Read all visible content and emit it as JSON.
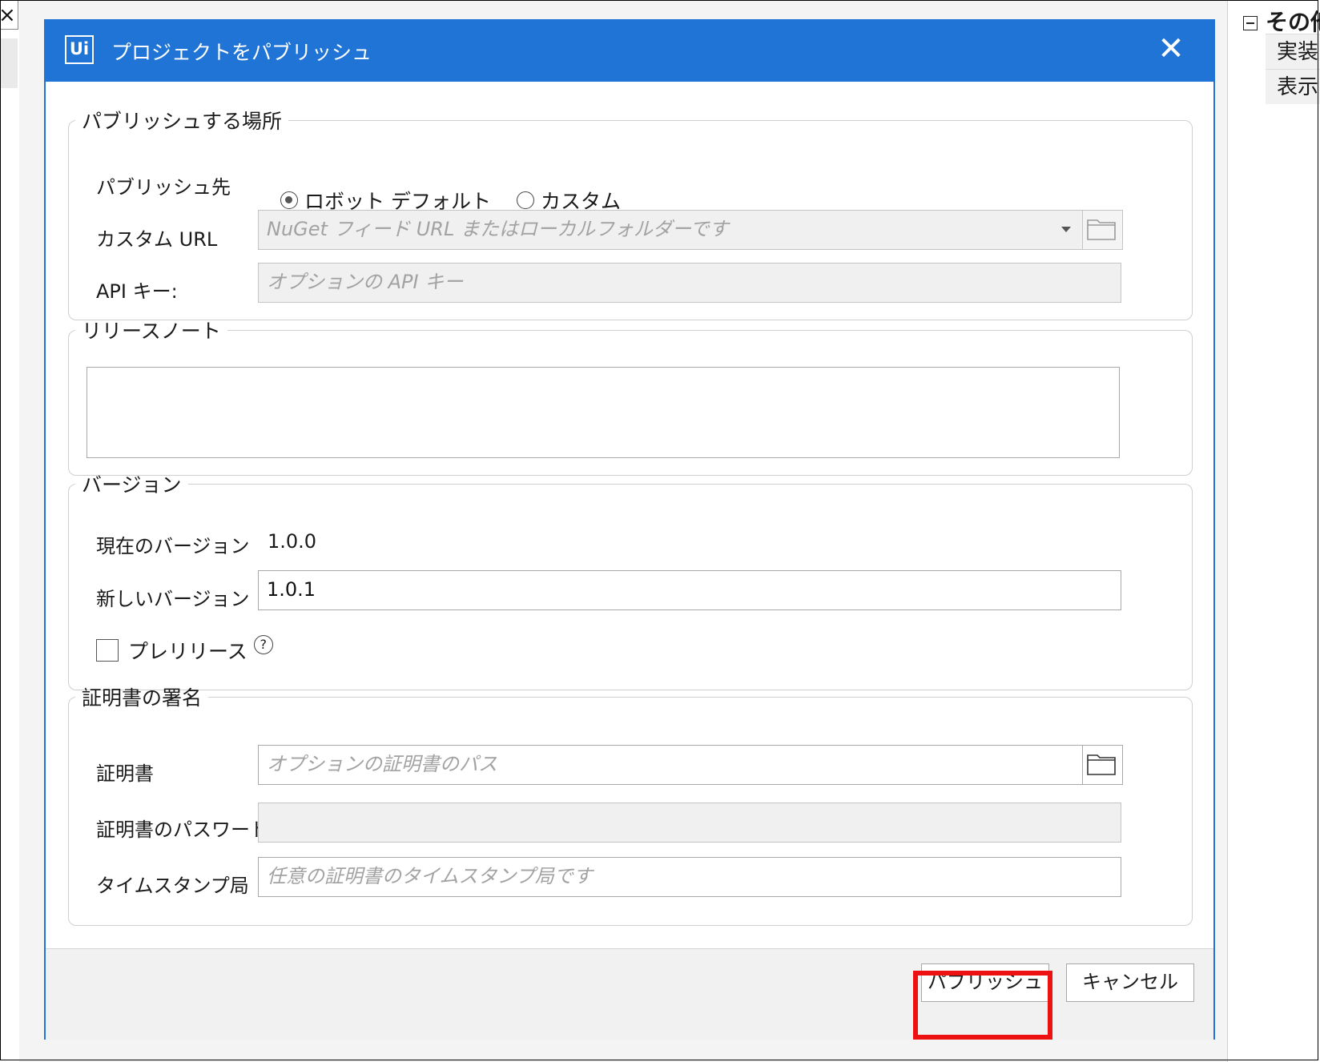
{
  "background": {
    "left_close_glyph": "×",
    "right_panel": {
      "heading": "その他",
      "rows": [
        "実装",
        "表示"
      ]
    }
  },
  "dialog": {
    "logo_text": "Ui",
    "title": "プロジェクトをパブリッシュ",
    "close_glyph": "✕",
    "publish_location": {
      "legend": "パブリッシュする場所",
      "target_label": "パブリッシュ先",
      "options": [
        "ロボット デフォルト",
        "カスタム"
      ],
      "selected_option": "ロボット デフォルト",
      "custom_url_label": "カスタム URL",
      "custom_url_placeholder": "NuGet フィード URL またはローカルフォルダーです",
      "api_key_label": "API キー:",
      "api_key_placeholder": "オプションの API キー"
    },
    "release_notes": {
      "legend": "リリースノート",
      "value": ""
    },
    "version": {
      "legend": "バージョン",
      "current_label": "現在のバージョン",
      "current_value": "1.0.0",
      "new_label": "新しいバージョン",
      "new_value": "1.0.1",
      "prerelease_label": "プレリリース",
      "prerelease_checked": false,
      "help_glyph": "?"
    },
    "certificate": {
      "legend": "証明書の署名",
      "cert_label": "証明書",
      "cert_placeholder": "オプションの証明書のパス",
      "password_label": "証明書のパスワード",
      "password_value": "",
      "timestamp_label": "タイムスタンプ局",
      "timestamp_placeholder": "任意の証明書のタイムスタンプ局です"
    },
    "buttons": {
      "publish": "パブリッシュ",
      "cancel": "キャンセル"
    }
  },
  "colors": {
    "accent": "#1f74d6",
    "highlight": "#ee1111"
  },
  "icons": [
    "app-logo-icon",
    "close-icon",
    "dropdown-arrow-icon",
    "folder-icon",
    "help-icon",
    "collapse-minus-icon"
  ]
}
